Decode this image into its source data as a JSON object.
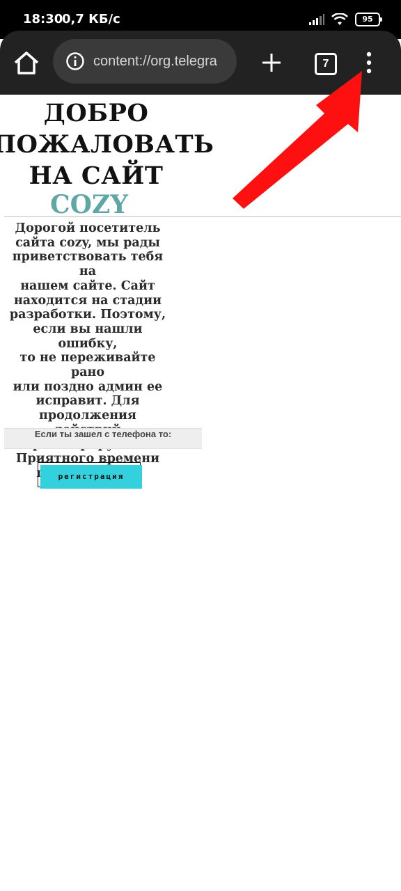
{
  "status_bar": {
    "time": "18:30",
    "net_speed": "0,7 КБ/с",
    "battery": "95",
    "icons": [
      "signal-icon",
      "wifi-icon",
      "battery-icon"
    ]
  },
  "browser": {
    "url": "content://org.telegra",
    "tab_count": "7",
    "icons": [
      "home-icon",
      "info-icon",
      "plus-icon",
      "tabs-icon",
      "kebab-menu-icon"
    ]
  },
  "page": {
    "hero_lines": [
      "ДОБРО",
      "ПОЖАЛОВАТЬ",
      "НА САЙТ"
    ],
    "brand": "COZY",
    "message_lines": [
      "Дорогой посетитель",
      "сайта cozy, мы рады",
      "приветствовать тебя на",
      "нашем сайте. Сайт",
      "находится на стадии",
      "разработки. Поэтому,",
      "если вы нашли ошибку,",
      "то не переживайте рано",
      "или поздно админ ее",
      "исправит. Для",
      "продолжения действий",
      "зарегистрируйтесь.",
      "Приятного времени",
      "провождения!"
    ],
    "phone_note": "Если ты зашел с телефона то:",
    "register_button": "регистрация"
  },
  "colors": {
    "brand": "#5fa6a6",
    "button": "#33d1dd",
    "arrow": "#ff1010",
    "toolbar": "#222222"
  }
}
